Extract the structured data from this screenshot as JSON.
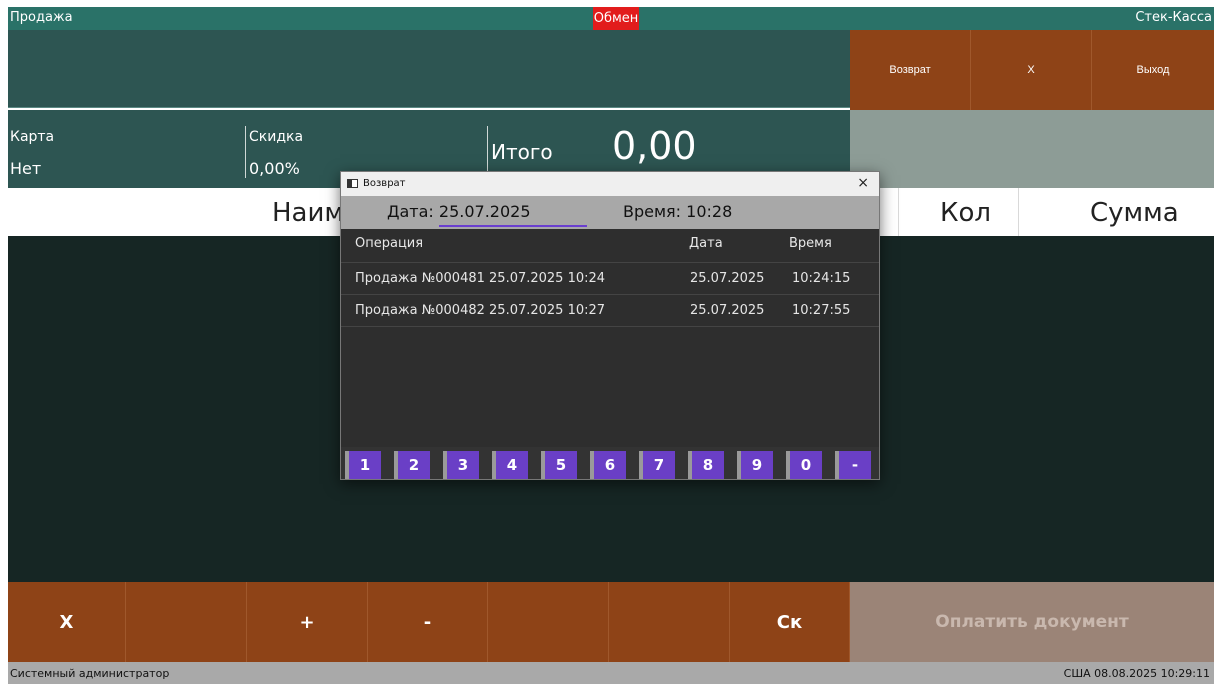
{
  "topbar": {
    "left": "Продажа",
    "center": "Обмен",
    "right": "Стек-Касса"
  },
  "header_buttons": [
    "Возврат",
    "X",
    "Выход"
  ],
  "info": {
    "card_label": "Карта",
    "card_value": "Нет",
    "discount_label": "Скидка",
    "discount_value": "0,00%",
    "total_label": "Итого",
    "total_value": "0,00"
  },
  "columns": {
    "name": "Наим",
    "qty": "Кол",
    "sum": "Сумма"
  },
  "bottom_buttons": [
    "X",
    "",
    "+",
    "-",
    "",
    "",
    "Ск"
  ],
  "pay_button": "Оплатить документ",
  "status": {
    "user": "Системный администратор",
    "right": "США   08.08.2025 10:29:11"
  },
  "dialog": {
    "title": "Возврат",
    "close": "×",
    "date_label": "Дата: 25.07.2025",
    "time_label": "Время: 10:28",
    "headers": {
      "op": "Операция",
      "date": "Дата",
      "time": "Время"
    },
    "rows": [
      {
        "op": "Продажа №000481 25.07.2025 10:24",
        "date": "25.07.2025",
        "time": "10:24:15"
      },
      {
        "op": "Продажа №000482 25.07.2025 10:27",
        "date": "25.07.2025",
        "time": "10:27:55"
      }
    ],
    "keys": [
      "1",
      "2",
      "3",
      "4",
      "5",
      "6",
      "7",
      "8",
      "9",
      "0",
      "-"
    ]
  },
  "colors": {
    "accent": "#8e4317",
    "teal": "#2a7268",
    "keypad": "#6a3fc6",
    "alert": "#e21c1c"
  }
}
